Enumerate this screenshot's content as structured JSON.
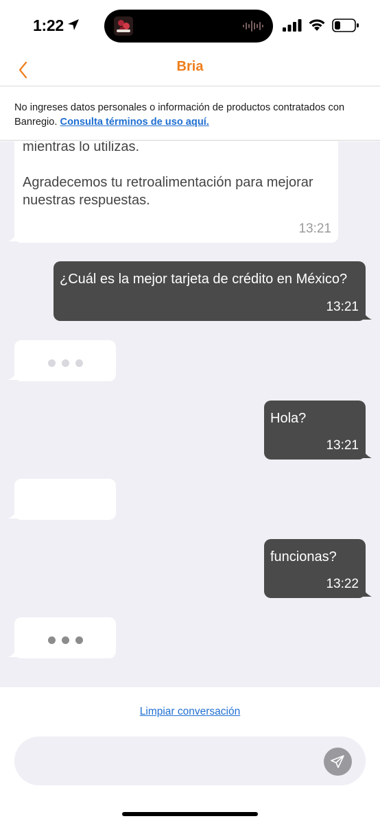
{
  "status_bar": {
    "time": "1:22",
    "icons": [
      "location-arrow-icon",
      "music-waveform-icon",
      "cellular-signal-icon",
      "wifi-icon",
      "battery-icon"
    ]
  },
  "header": {
    "title": "Bria",
    "back_icon": "chevron-left-icon",
    "accent_color": "#ef7d1a"
  },
  "notice": {
    "text": "No ingreses datos personales o información de productos contratados con Banregio. ",
    "link": "Consulta términos de uso aquí."
  },
  "messages": [
    {
      "sender": "bot",
      "paragraphs": [
        "mientras lo utilizas.",
        "Agradecemos tu retroalimentación para mejorar nuestras respuestas."
      ],
      "time": "13:21"
    },
    {
      "sender": "user",
      "text": "¿Cuál es la mejor tarjeta de crédito en México?",
      "time": "13:21"
    },
    {
      "sender": "bot",
      "typing": true,
      "state": "faint"
    },
    {
      "sender": "user",
      "text": "Hola?",
      "time": "13:21"
    },
    {
      "sender": "bot",
      "typing": false,
      "empty": true
    },
    {
      "sender": "user",
      "text": "funcionas?",
      "time": "13:22"
    },
    {
      "sender": "bot",
      "typing": true,
      "state": "solid"
    }
  ],
  "footer": {
    "clear_label": "Limpiar conversación",
    "input_value": "",
    "input_placeholder": "",
    "send_icon": "send-paper-plane-icon"
  },
  "colors": {
    "user_bubble": "#4a4a4a",
    "bot_bubble": "#ffffff",
    "chat_background": "#efeff5",
    "link": "#1f6fd1"
  }
}
